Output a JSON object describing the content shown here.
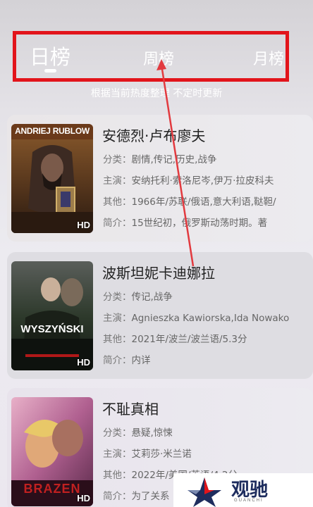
{
  "tabs": {
    "day": "日榜",
    "week": "周榜",
    "month": "月榜"
  },
  "subtitle": "根据当前热度整理 不定时更新",
  "badge": "HD",
  "labels": {
    "category": "分类：",
    "cast": "主演：",
    "other": "其他：",
    "intro": "简介："
  },
  "movies": [
    {
      "title": "安德烈·卢布廖夫",
      "poster_text": "ANDRIEJ RUBLOW",
      "category": "剧情,传记,历史,战争",
      "cast": "安纳托利·索洛尼岑,伊万·拉皮科夫",
      "other": "1966年/苏联/俄语,意大利语,鞑靼/",
      "intro": "15世纪初，俄罗斯动荡时期。著"
    },
    {
      "title": "波斯坦妮卡迪娜拉",
      "poster_text": "WYSZYŃSKI",
      "category": "传记,战争",
      "cast": "Agnieszka Kawiorska,Ida Nowako",
      "other": "2021年/波兰/波兰语/5.3分",
      "intro": "内详"
    },
    {
      "title": "不耻真相",
      "poster_text": "BRAZEN",
      "category": "悬疑,惊悚",
      "cast": "艾莉莎·米兰诺",
      "other": "2022年/美国/英语/4.2分",
      "intro": "为了关系"
    }
  ],
  "watermark": {
    "text": "观驰",
    "sub": "GUANCHI"
  },
  "colors": {
    "highlight": "#e2141b",
    "arrow": "#e23a3f"
  }
}
